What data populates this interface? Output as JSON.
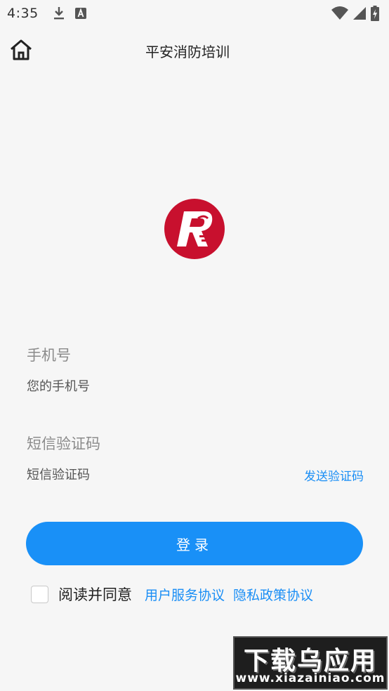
{
  "status_bar": {
    "time": "4:35",
    "icons": [
      "download-icon",
      "font-app-icon",
      "wifi-icon",
      "signal-icon",
      "battery-charging-icon"
    ]
  },
  "header": {
    "title": "平安消防培训",
    "home_icon": "home-icon"
  },
  "logo": {
    "letter": "R",
    "color": "#c8102e"
  },
  "form": {
    "phone_label": "手机号",
    "phone_placeholder": "您的手机号",
    "code_label": "短信验证码",
    "code_placeholder": "短信验证码",
    "send_code": "发送验证码"
  },
  "login_button": "登录",
  "agreement": {
    "text": "阅读并同意",
    "user_agreement": "用户服务协议",
    "privacy_policy": "隐私政策协议",
    "checked": false
  },
  "watermark": {
    "main": "下载乌应用",
    "sub": "www.xiazainiao.com"
  },
  "colors": {
    "accent": "#1990f7",
    "link": "#1a8ef5",
    "background": "#f6f6f6"
  }
}
